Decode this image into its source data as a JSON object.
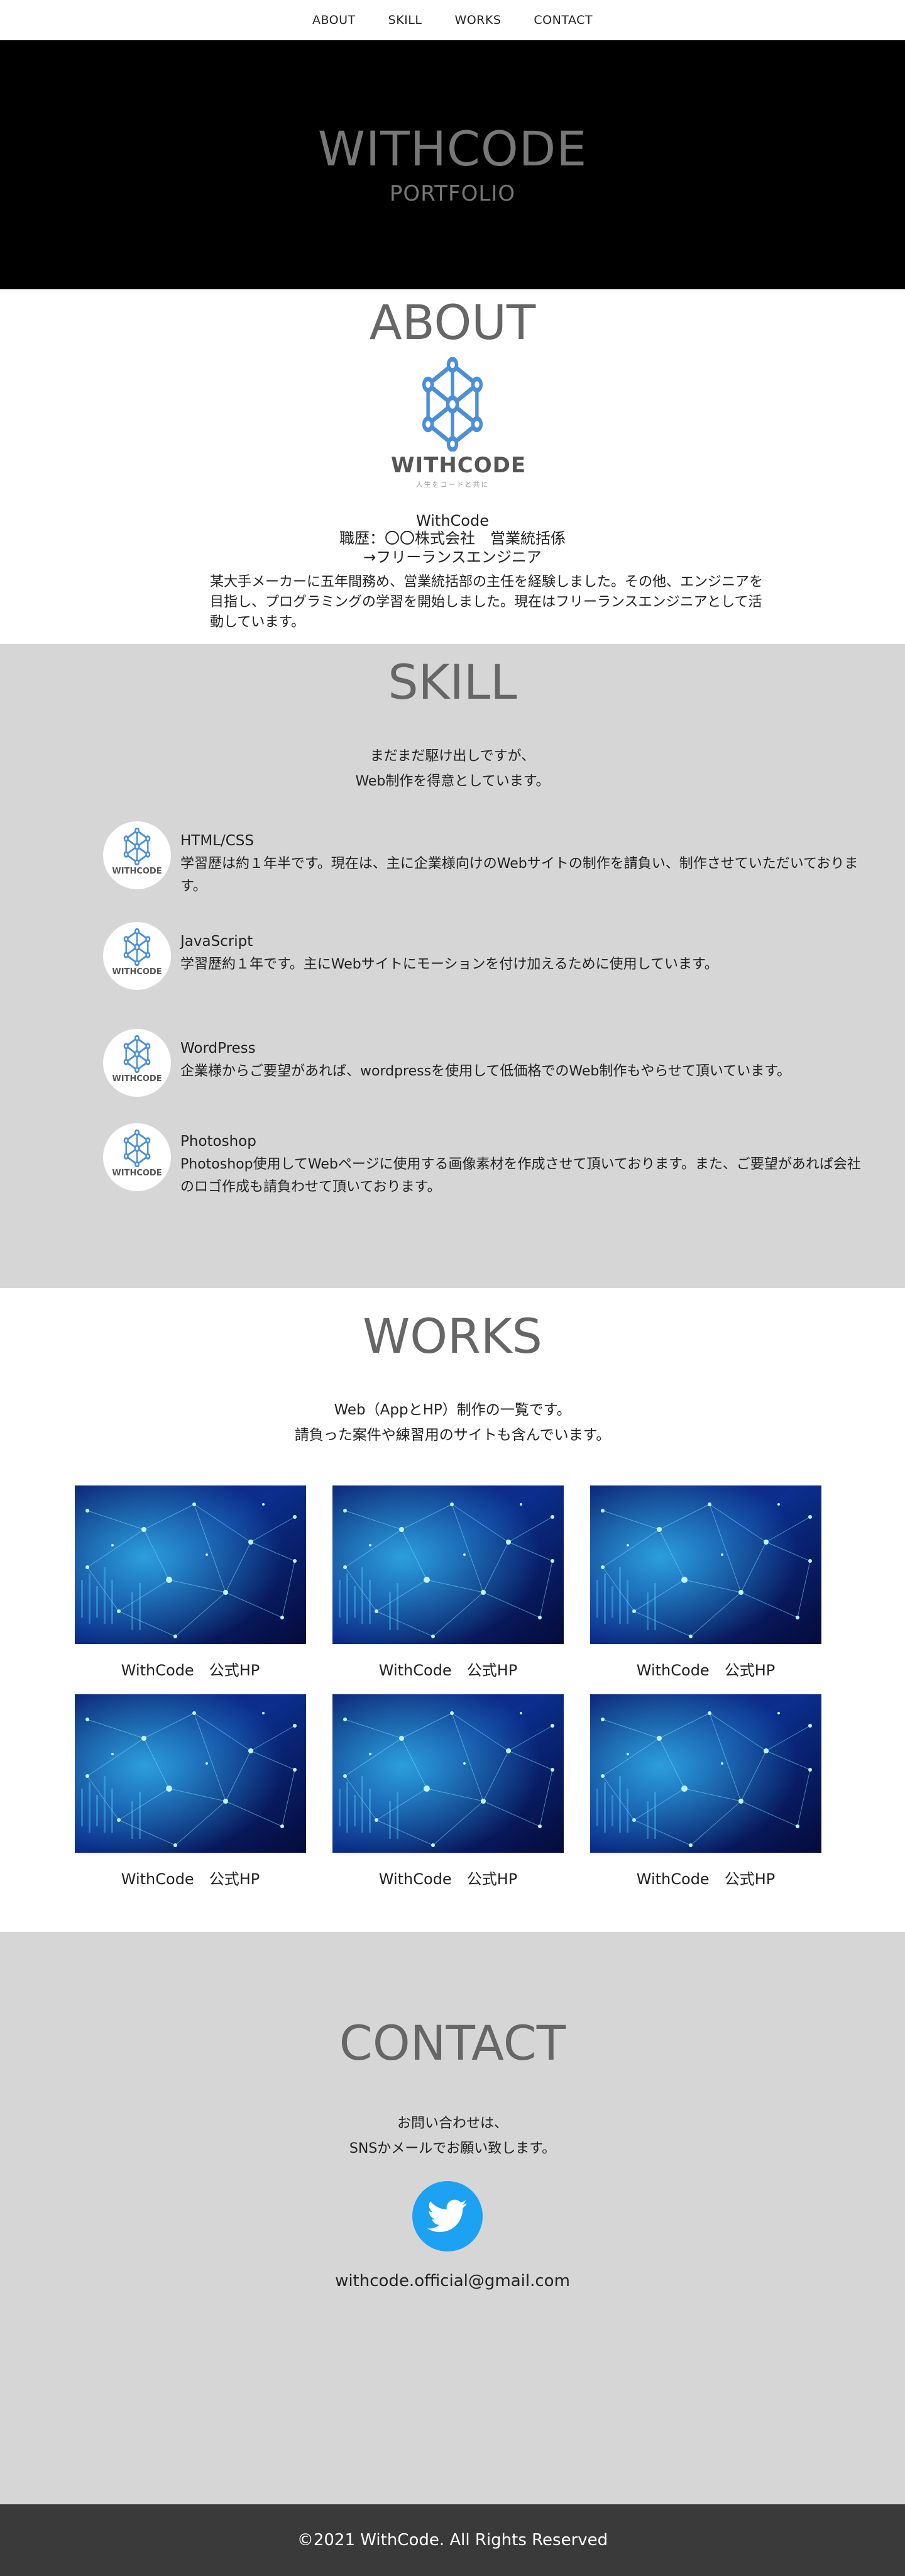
{
  "nav": {
    "items": [
      "ABOUT",
      "SKILL",
      "WORKS",
      "CONTACT"
    ]
  },
  "hero": {
    "title": "WITHCODE",
    "subtitle": "PORTFOLIO"
  },
  "about": {
    "title": "ABOUT",
    "logo_word": "WITHCODE",
    "logo_tagline": "人生をコードと共に",
    "name": "WithCode",
    "career_line1": "職歴：〇〇株式会社　営業統括係",
    "career_line2": "→フリーランスエンジニア",
    "description": "某大手メーカーに五年間務め、営業統括部の主任を経験しました。その他、エンジニアを目指し、プログラミングの学習を開始しました。現在はフリーランスエンジニアとして活動しています。"
  },
  "skill": {
    "title": "SKILL",
    "intro_line1": "まだまだ駆け出しですが、",
    "intro_line2": "Web制作を得意としています。",
    "icon_word": "WITHCODE",
    "items": [
      {
        "name": "HTML/CSS",
        "desc": "学習歴は約１年半です。現在は、主に企業様向けのWebサイトの制作を請負い、制作させていただいております。"
      },
      {
        "name": "JavaScript",
        "desc": "学習歴約１年です。主にWebサイトにモーションを付け加えるために使用しています。"
      },
      {
        "name": "WordPress",
        "desc": "企業様からご要望があれば、wordpressを使用して低価格でのWeb制作もやらせて頂いています。"
      },
      {
        "name": "Photoshop",
        "desc": "Photoshop使用してWebページに使用する画像素材を作成させて頂いております。また、ご要望があれば会社のロゴ作成も請負わせて頂いております。"
      }
    ]
  },
  "works": {
    "title": "WORKS",
    "intro_line1": "Web（AppとHP）制作の一覧です。",
    "intro_line2": "請負った案件や練習用のサイトも含んでいます。",
    "items": [
      {
        "label": "WithCode　公式HP"
      },
      {
        "label": "WithCode　公式HP"
      },
      {
        "label": "WithCode　公式HP"
      },
      {
        "label": "WithCode　公式HP"
      },
      {
        "label": "WithCode　公式HP"
      },
      {
        "label": "WithCode　公式HP"
      }
    ]
  },
  "contact": {
    "title": "CONTACT",
    "intro_line1": "お問い合わせは、",
    "intro_line2": "SNSかメールでお願い致します。",
    "twitter_icon": "twitter-icon",
    "twitter_color": "#1da1f2",
    "email": "withcode.official@gmail.com"
  },
  "footer": {
    "copyright": "©2021 WithCode. All Rights Reserved"
  },
  "colors": {
    "hero_bg": "#000000",
    "section_gray": "#d7d6d7",
    "footer_bg": "#3a3a3a",
    "logo_blue": "#4a90d9"
  }
}
